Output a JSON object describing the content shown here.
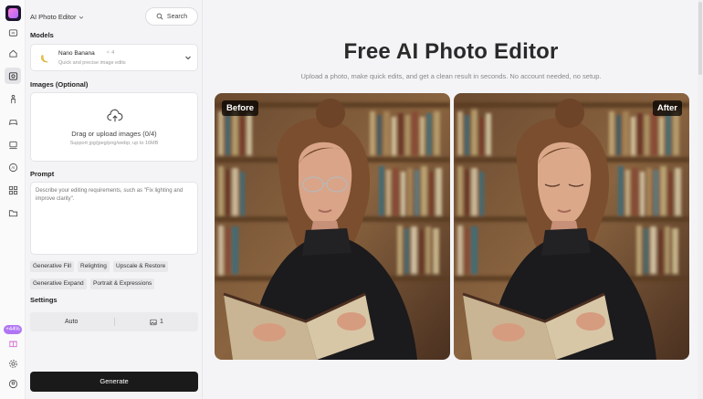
{
  "rail": {
    "icons": [
      "app-logo",
      "chat-icon",
      "home-icon",
      "photo-editor-icon",
      "figure-icon",
      "games-icon",
      "stamp-icon",
      "ai-icon",
      "apps-icon",
      "folder-icon",
      "gift-icon",
      "settings-icon",
      "user-icon"
    ],
    "badge": "+44%"
  },
  "panel": {
    "app_title": "AI Photo Editor",
    "search_label": "Search",
    "models_label": "Models",
    "model": {
      "name": "Nano Banana",
      "cost": "✧ 4",
      "description": "Quick and precise image edits"
    },
    "images_label": "Images (Optional)",
    "upload": {
      "title": "Drag or upload images  (0/4)",
      "hint": "Support jpg/jpeg/png/webp, up to 16MB"
    },
    "prompt_label": "Prompt",
    "prompt_placeholder": "Describe your editing requirements, such as \"Fix lighting and improve clarity\".",
    "chips": [
      "Generative Fill",
      "Relighting",
      "Upscale & Restore",
      "Generative Expand",
      "Portrait & Expressions"
    ],
    "settings_label": "Settings",
    "settings": {
      "ratio": "Auto",
      "count": "1"
    },
    "generate_label": "Generate"
  },
  "main": {
    "title": "Free AI Photo Editor",
    "subtitle": "Upload a photo, make quick edits, and get a clean result in seconds. No account needed, no setup.",
    "before_label": "Before",
    "after_label": "After"
  },
  "colors": {
    "accent": "#b074f5",
    "generate_bg": "#1a1a1a"
  }
}
